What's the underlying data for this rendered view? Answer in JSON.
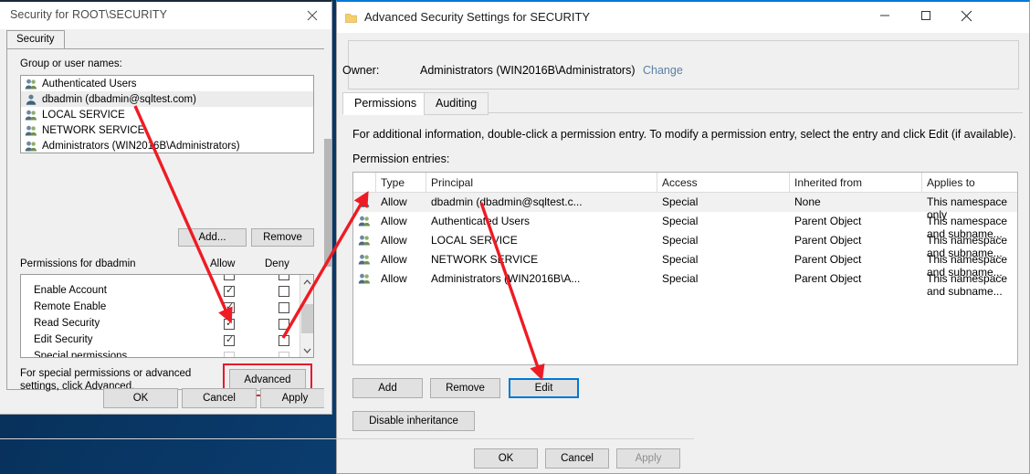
{
  "desktop": {
    "background_color": "#0a3c6e"
  },
  "left_dialog": {
    "title": "Security for ROOT\\SECURITY",
    "close_icon": "close-icon",
    "tab_label": "Security",
    "group_users_label": "Group or user names:",
    "group_users": [
      {
        "name": "Authenticated Users",
        "icon": "users-group-icon",
        "selected": false
      },
      {
        "name": "dbadmin (dbadmin@sqltest.com)",
        "icon": "single-user-icon",
        "selected": true
      },
      {
        "name": "LOCAL SERVICE",
        "icon": "users-group-icon",
        "selected": false
      },
      {
        "name": "NETWORK SERVICE",
        "icon": "users-group-icon",
        "selected": false
      },
      {
        "name": "Administrators (WIN2016B\\Administrators)",
        "icon": "users-group-icon",
        "selected": false
      }
    ],
    "add_label": "Add...",
    "remove_label": "Remove",
    "permissions_label": "Permissions for dbadmin",
    "allow_header": "Allow",
    "deny_header": "Deny",
    "permission_rows": [
      {
        "name": "",
        "allow": true,
        "deny": false,
        "dim": false,
        "partial": true
      },
      {
        "name": "Enable Account",
        "allow": true,
        "deny": false,
        "dim": false
      },
      {
        "name": "Remote Enable",
        "allow": true,
        "deny": false,
        "dim": false
      },
      {
        "name": "Read Security",
        "allow": true,
        "deny": false,
        "dim": false
      },
      {
        "name": "Edit Security",
        "allow": true,
        "deny": false,
        "dim": false
      },
      {
        "name": "Special permissions",
        "allow": false,
        "deny": false,
        "dim": true
      }
    ],
    "scrollbar": {
      "up_icon": "chevron-up-icon",
      "down_icon": "chevron-down-icon"
    },
    "advanced_note": "For special permissions or advanced settings, click Advanced.",
    "advanced_label": "Advanced",
    "highlight_color": "#e8172b",
    "ok_label": "OK",
    "cancel_label": "Cancel",
    "apply_label": "Apply"
  },
  "right_dialog": {
    "title": "Advanced Security Settings for SECURITY",
    "folder_icon": "folder-icon",
    "minimize_icon": "minimize-icon",
    "maximize_icon": "maximize-icon",
    "close_icon": "close-icon",
    "owner_label": "Owner:",
    "owner_value": "Administrators (WIN2016B\\Administrators)",
    "owner_change_link": "Change",
    "tabs": [
      {
        "label": "Permissions",
        "active": true
      },
      {
        "label": "Auditing",
        "active": false
      }
    ],
    "info_text": "For additional information, double-click a permission entry. To modify a permission entry, select the entry and click Edit (if available).",
    "entries_label": "Permission entries:",
    "table": {
      "columns": [
        "Type",
        "Principal",
        "Access",
        "Inherited from",
        "Applies to"
      ],
      "rows": [
        {
          "icon": "single-user-icon",
          "type": "Allow",
          "principal": "dbadmin (dbadmin@sqltest.c...",
          "access": "Special",
          "inherited_from": "None",
          "applies_to": "This namespace only",
          "selected": true
        },
        {
          "icon": "users-group-icon",
          "type": "Allow",
          "principal": "Authenticated Users",
          "access": "Special",
          "inherited_from": "Parent Object",
          "applies_to": "This namespace and subname...",
          "selected": false
        },
        {
          "icon": "users-group-icon",
          "type": "Allow",
          "principal": "LOCAL SERVICE",
          "access": "Special",
          "inherited_from": "Parent Object",
          "applies_to": "This namespace and subname...",
          "selected": false
        },
        {
          "icon": "users-group-icon",
          "type": "Allow",
          "principal": "NETWORK SERVICE",
          "access": "Special",
          "inherited_from": "Parent Object",
          "applies_to": "This namespace and subname...",
          "selected": false
        },
        {
          "icon": "users-group-icon",
          "type": "Allow",
          "principal": "Administrators (WIN2016B\\A...",
          "access": "Special",
          "inherited_from": "Parent Object",
          "applies_to": "This namespace and subname...",
          "selected": false
        }
      ]
    },
    "add_label": "Add",
    "remove_label": "Remove",
    "edit_label": "Edit",
    "edit_focus_color": "#0078d7",
    "disable_inheritance_label": "Disable inheritance",
    "ok_label": "OK",
    "cancel_label": "Cancel",
    "apply_label": "Apply",
    "apply_disabled": true
  },
  "annotations": {
    "color": "#ee1b24",
    "arrows": [
      {
        "name": "arrow-dbadmin-to-advanced",
        "from": "dbadmin row in group list",
        "to": "Advanced button"
      },
      {
        "name": "arrow-advanced-to-entry",
        "from": "Advanced button",
        "to": "first permission entry row"
      },
      {
        "name": "arrow-entry-to-edit",
        "from": "dbadmin permission entry",
        "to": "Edit button"
      }
    ]
  }
}
